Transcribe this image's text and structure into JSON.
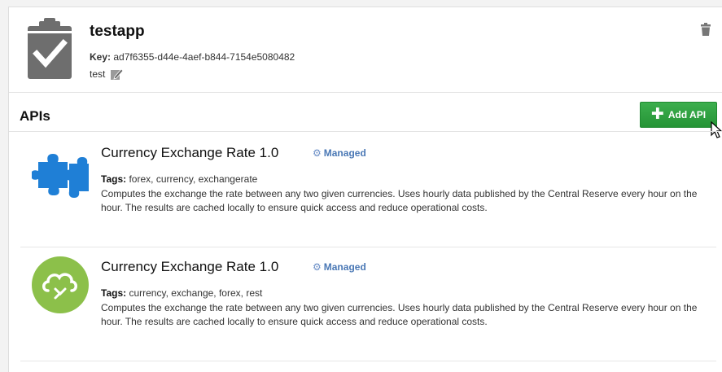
{
  "app": {
    "name": "testapp",
    "key_label": "Key:",
    "key_value": "ad7f6355-d44e-4aef-b844-7154e5080482",
    "description": "test",
    "icon": "clipboard-check-icon"
  },
  "apis_section": {
    "title": "APIs",
    "add_button_label": "Add API"
  },
  "apis": [
    {
      "name": "Currency Exchange Rate 1.0",
      "badge": "Managed",
      "tags_label": "Tags:",
      "tags": "forex, currency, exchangerate",
      "description": "Computes the exchange the rate between any two given currencies. Uses hourly data published by the Central Reserve every hour on the hour. The results are cached locally to ensure quick access and reduce operational costs.",
      "icon": "puzzle-icon"
    },
    {
      "name": "Currency Exchange Rate 1.0",
      "badge": "Managed",
      "tags_label": "Tags:",
      "tags": "currency, exchange, forex, rest",
      "description": "Computes the exchange the rate between any two given currencies. Uses hourly data published by the Central Reserve every hour on the hour. The results are cached locally to ensure quick access and reduce operational costs.",
      "icon": "cloud-icon"
    }
  ],
  "colors": {
    "add_button": "#2e9e40",
    "managed": "#4a78b5",
    "puzzle": "#1f7fd6",
    "cloud_circle": "#8cc04a"
  }
}
